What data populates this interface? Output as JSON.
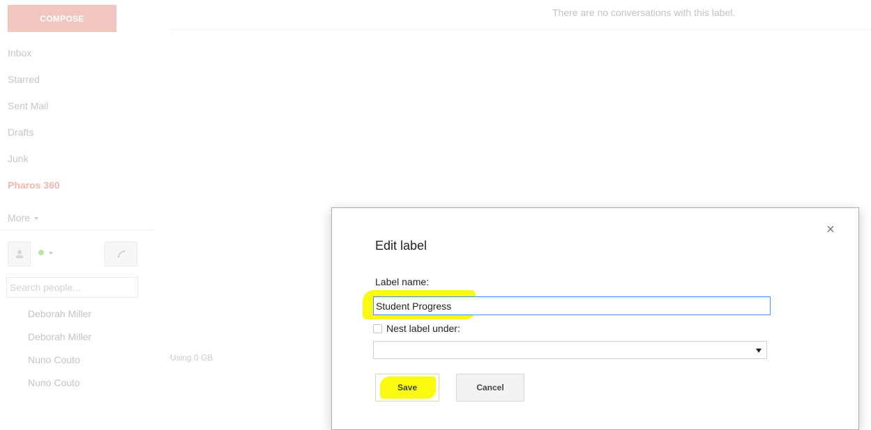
{
  "sidebar": {
    "compose_label": "COMPOSE",
    "nav_items": [
      {
        "label": "Inbox"
      },
      {
        "label": "Starred"
      },
      {
        "label": "Sent Mail"
      },
      {
        "label": "Drafts"
      },
      {
        "label": "Junk"
      },
      {
        "label": "Pharos 360"
      }
    ],
    "more_label": "More",
    "search_people_placeholder": "Search people...",
    "contacts": [
      {
        "name": "Deborah Miller"
      },
      {
        "name": "Deborah Miller"
      },
      {
        "name": "Nuno Couto"
      },
      {
        "name": "Nuno Couto"
      }
    ]
  },
  "main": {
    "empty_message": "There are no conversations with this label.",
    "storage": "Using 0 GB"
  },
  "dialog": {
    "title": "Edit label",
    "close_glyph": "×",
    "label_name_label": "Label name:",
    "label_name_value": "Student Progress",
    "nest_label": "Nest label under:",
    "nest_checked": false,
    "nest_selected": "",
    "save_label": "Save",
    "cancel_label": "Cancel"
  },
  "colors": {
    "highlight": "#fafa10",
    "compose_bg": "#f2c6c0",
    "active_nav": "#f2b6ae",
    "focus_border": "#4d90fe",
    "status_online": "#b7e2a8"
  }
}
